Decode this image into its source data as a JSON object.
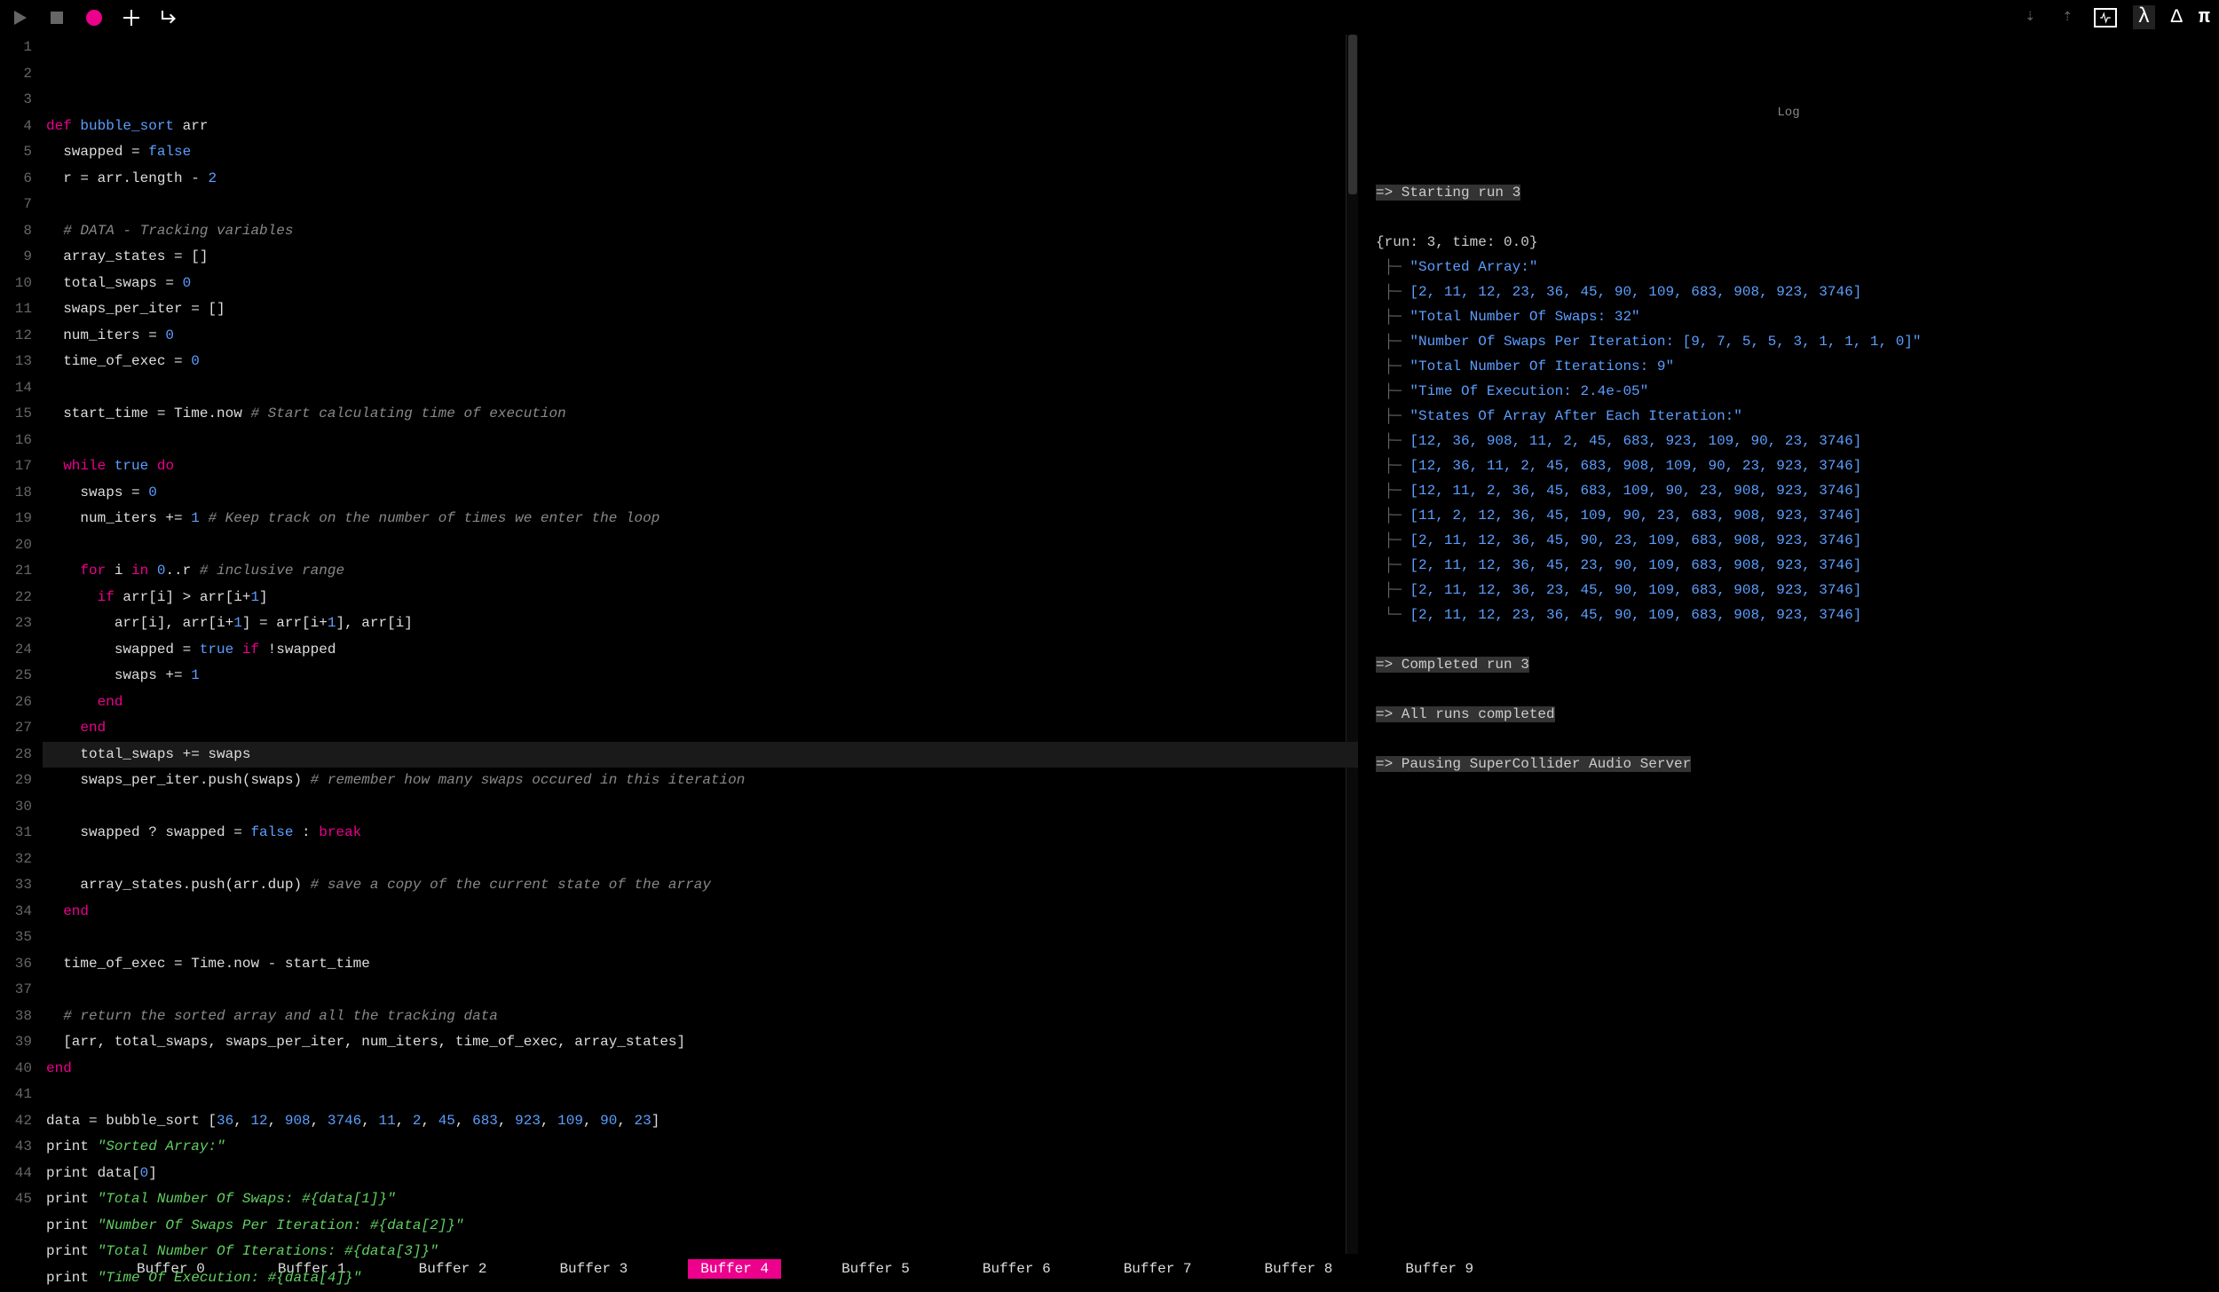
{
  "toolbar": {
    "icons_left": [
      "play-icon",
      "stop-icon",
      "record-icon",
      "plus-icon",
      "return-icon"
    ],
    "icons_right": [
      "drag-down-icon",
      "drag-up-icon",
      "activity-icon",
      "lambda-icon",
      "delta-icon",
      "pi-icon"
    ]
  },
  "editor": {
    "highlighted_line": 28,
    "cursor_col": 21,
    "lines": [
      {
        "n": 1,
        "tokens": [
          [
            "kw",
            "def "
          ],
          [
            "fn",
            "bubble_sort"
          ],
          [
            "txt",
            " arr"
          ]
        ]
      },
      {
        "n": 2,
        "tokens": [
          [
            "txt",
            "  swapped = "
          ],
          [
            "bool",
            "false"
          ]
        ]
      },
      {
        "n": 3,
        "tokens": [
          [
            "txt",
            "  r = arr.length - "
          ],
          [
            "num",
            "2"
          ]
        ]
      },
      {
        "n": 4,
        "tokens": []
      },
      {
        "n": 5,
        "tokens": [
          [
            "txt",
            "  "
          ],
          [
            "cm",
            "# DATA - Tracking variables"
          ]
        ]
      },
      {
        "n": 6,
        "tokens": [
          [
            "txt",
            "  array_states = []"
          ]
        ]
      },
      {
        "n": 7,
        "tokens": [
          [
            "txt",
            "  total_swaps = "
          ],
          [
            "num",
            "0"
          ]
        ]
      },
      {
        "n": 8,
        "tokens": [
          [
            "txt",
            "  swaps_per_iter = []"
          ]
        ]
      },
      {
        "n": 9,
        "tokens": [
          [
            "txt",
            "  num_iters = "
          ],
          [
            "num",
            "0"
          ]
        ]
      },
      {
        "n": 10,
        "tokens": [
          [
            "txt",
            "  time_of_exec = "
          ],
          [
            "num",
            "0"
          ]
        ]
      },
      {
        "n": 11,
        "tokens": []
      },
      {
        "n": 12,
        "tokens": [
          [
            "txt",
            "  start_time = Time.now "
          ],
          [
            "cm",
            "# Start calculating time of execution"
          ]
        ]
      },
      {
        "n": 13,
        "tokens": []
      },
      {
        "n": 14,
        "tokens": [
          [
            "txt",
            "  "
          ],
          [
            "kw",
            "while"
          ],
          [
            "txt",
            " "
          ],
          [
            "bool",
            "true"
          ],
          [
            "txt",
            " "
          ],
          [
            "kw",
            "do"
          ]
        ]
      },
      {
        "n": 15,
        "tokens": [
          [
            "txt",
            "    swaps = "
          ],
          [
            "num",
            "0"
          ]
        ]
      },
      {
        "n": 16,
        "tokens": [
          [
            "txt",
            "    num_iters += "
          ],
          [
            "num",
            "1"
          ],
          [
            "txt",
            " "
          ],
          [
            "cm",
            "# Keep track on the number of times we enter the loop"
          ]
        ]
      },
      {
        "n": 17,
        "tokens": []
      },
      {
        "n": 18,
        "tokens": [
          [
            "txt",
            "    "
          ],
          [
            "kw",
            "for"
          ],
          [
            "txt",
            " i "
          ],
          [
            "kw",
            "in"
          ],
          [
            "txt",
            " "
          ],
          [
            "num",
            "0"
          ],
          [
            "txt",
            "..r "
          ],
          [
            "cm",
            "# inclusive range"
          ]
        ]
      },
      {
        "n": 19,
        "tokens": [
          [
            "txt",
            "      "
          ],
          [
            "kw",
            "if"
          ],
          [
            "txt",
            " arr[i] > arr[i+"
          ],
          [
            "num",
            "1"
          ],
          [
            "txt",
            "]"
          ]
        ]
      },
      {
        "n": 20,
        "tokens": [
          [
            "txt",
            "        arr[i], arr[i+"
          ],
          [
            "num",
            "1"
          ],
          [
            "txt",
            "] = arr[i+"
          ],
          [
            "num",
            "1"
          ],
          [
            "txt",
            "], arr[i]"
          ]
        ]
      },
      {
        "n": 21,
        "tokens": [
          [
            "txt",
            "        swapped = "
          ],
          [
            "bool",
            "true"
          ],
          [
            "txt",
            " "
          ],
          [
            "kw",
            "if"
          ],
          [
            "txt",
            " !swapped"
          ]
        ]
      },
      {
        "n": 22,
        "tokens": [
          [
            "txt",
            "        swaps += "
          ],
          [
            "num",
            "1"
          ]
        ]
      },
      {
        "n": 23,
        "tokens": [
          [
            "txt",
            "      "
          ],
          [
            "kw",
            "end"
          ]
        ]
      },
      {
        "n": 24,
        "tokens": [
          [
            "txt",
            "    "
          ],
          [
            "kw",
            "end"
          ]
        ]
      },
      {
        "n": 25,
        "tokens": [
          [
            "txt",
            "    total_swaps += swaps"
          ]
        ]
      },
      {
        "n": 26,
        "tokens": [
          [
            "txt",
            "    swaps_per_iter.push(swaps) "
          ],
          [
            "cm",
            "# remember how many swaps occured in this iteration"
          ]
        ]
      },
      {
        "n": 27,
        "tokens": []
      },
      {
        "n": 28,
        "tokens": [
          [
            "txt",
            "    swapped ? swapped = "
          ],
          [
            "bool",
            "false"
          ],
          [
            "txt",
            " : "
          ],
          [
            "kw",
            "break"
          ]
        ]
      },
      {
        "n": 29,
        "tokens": []
      },
      {
        "n": 30,
        "tokens": [
          [
            "txt",
            "    array_states.push(arr.dup) "
          ],
          [
            "cm",
            "# save a copy of the current state of the array"
          ]
        ]
      },
      {
        "n": 31,
        "tokens": [
          [
            "txt",
            "  "
          ],
          [
            "kw",
            "end"
          ]
        ]
      },
      {
        "n": 32,
        "tokens": []
      },
      {
        "n": 33,
        "tokens": [
          [
            "txt",
            "  time_of_exec = Time.now - start_time"
          ]
        ]
      },
      {
        "n": 34,
        "tokens": []
      },
      {
        "n": 35,
        "tokens": [
          [
            "txt",
            "  "
          ],
          [
            "cm",
            "# return the sorted array and all the tracking data"
          ]
        ]
      },
      {
        "n": 36,
        "tokens": [
          [
            "txt",
            "  [arr, total_swaps, swaps_per_iter, num_iters, time_of_exec, array_states]"
          ]
        ]
      },
      {
        "n": 37,
        "tokens": [
          [
            "kw",
            "end"
          ]
        ]
      },
      {
        "n": 38,
        "tokens": []
      },
      {
        "n": 39,
        "tokens": [
          [
            "txt",
            "data = bubble_sort ["
          ],
          [
            "num",
            "36"
          ],
          [
            "txt",
            ", "
          ],
          [
            "num",
            "12"
          ],
          [
            "txt",
            ", "
          ],
          [
            "num",
            "908"
          ],
          [
            "txt",
            ", "
          ],
          [
            "num",
            "3746"
          ],
          [
            "txt",
            ", "
          ],
          [
            "num",
            "11"
          ],
          [
            "txt",
            ", "
          ],
          [
            "num",
            "2"
          ],
          [
            "txt",
            ", "
          ],
          [
            "num",
            "45"
          ],
          [
            "txt",
            ", "
          ],
          [
            "num",
            "683"
          ],
          [
            "txt",
            ", "
          ],
          [
            "num",
            "923"
          ],
          [
            "txt",
            ", "
          ],
          [
            "num",
            "109"
          ],
          [
            "txt",
            ", "
          ],
          [
            "num",
            "90"
          ],
          [
            "txt",
            ", "
          ],
          [
            "num",
            "23"
          ],
          [
            "txt",
            "]"
          ]
        ]
      },
      {
        "n": 40,
        "tokens": [
          [
            "txt",
            "print "
          ],
          [
            "str",
            "\"Sorted Array:\""
          ]
        ]
      },
      {
        "n": 41,
        "tokens": [
          [
            "txt",
            "print data["
          ],
          [
            "num",
            "0"
          ],
          [
            "txt",
            "]"
          ]
        ]
      },
      {
        "n": 42,
        "tokens": [
          [
            "txt",
            "print "
          ],
          [
            "str",
            "\"Total Number Of Swaps: #{data[1]}\""
          ]
        ]
      },
      {
        "n": 43,
        "tokens": [
          [
            "txt",
            "print "
          ],
          [
            "str",
            "\"Number Of Swaps Per Iteration: #{data[2]}\""
          ]
        ]
      },
      {
        "n": 44,
        "tokens": [
          [
            "txt",
            "print "
          ],
          [
            "str",
            "\"Total Number Of Iterations: #{data[3]}\""
          ]
        ]
      },
      {
        "n": 45,
        "tokens": [
          [
            "txt",
            "print "
          ],
          [
            "str",
            "\"Time Of Execution: #{data[4]}\""
          ]
        ]
      }
    ]
  },
  "log": {
    "title": "Log",
    "lines": [
      {
        "cls": "log-hdr",
        "text": "=> Starting run 3"
      },
      {
        "cls": "log-info",
        "text": ""
      },
      {
        "cls": "log-info",
        "text": "{run: 3, time: 0.0}"
      },
      {
        "cls": "log-blue",
        "tree": " ├─ ",
        "text": "\"Sorted Array:\""
      },
      {
        "cls": "log-blue",
        "tree": " ├─ ",
        "text": "[2, 11, 12, 23, 36, 45, 90, 109, 683, 908, 923, 3746]"
      },
      {
        "cls": "log-blue",
        "tree": " ├─ ",
        "text": "\"Total Number Of Swaps: 32\""
      },
      {
        "cls": "log-blue",
        "tree": " ├─ ",
        "text": "\"Number Of Swaps Per Iteration: [9, 7, 5, 5, 3, 1, 1, 1, 0]\""
      },
      {
        "cls": "log-blue",
        "tree": " ├─ ",
        "text": "\"Total Number Of Iterations: 9\""
      },
      {
        "cls": "log-blue",
        "tree": " ├─ ",
        "text": "\"Time Of Execution: 2.4e-05\""
      },
      {
        "cls": "log-blue",
        "tree": " ├─ ",
        "text": "\"States Of Array After Each Iteration:\""
      },
      {
        "cls": "log-blue",
        "tree": " ├─ ",
        "text": "[12, 36, 908, 11, 2, 45, 683, 923, 109, 90, 23, 3746]"
      },
      {
        "cls": "log-blue",
        "tree": " ├─ ",
        "text": "[12, 36, 11, 2, 45, 683, 908, 109, 90, 23, 923, 3746]"
      },
      {
        "cls": "log-blue",
        "tree": " ├─ ",
        "text": "[12, 11, 2, 36, 45, 683, 109, 90, 23, 908, 923, 3746]"
      },
      {
        "cls": "log-blue",
        "tree": " ├─ ",
        "text": "[11, 2, 12, 36, 45, 109, 90, 23, 683, 908, 923, 3746]"
      },
      {
        "cls": "log-blue",
        "tree": " ├─ ",
        "text": "[2, 11, 12, 36, 45, 90, 23, 109, 683, 908, 923, 3746]"
      },
      {
        "cls": "log-blue",
        "tree": " ├─ ",
        "text": "[2, 11, 12, 36, 45, 23, 90, 109, 683, 908, 923, 3746]"
      },
      {
        "cls": "log-blue",
        "tree": " ├─ ",
        "text": "[2, 11, 12, 36, 23, 45, 90, 109, 683, 908, 923, 3746]"
      },
      {
        "cls": "log-blue",
        "tree": " └─ ",
        "text": "[2, 11, 12, 23, 36, 45, 90, 109, 683, 908, 923, 3746]"
      },
      {
        "cls": "log-info",
        "text": ""
      },
      {
        "cls": "log-hdr",
        "text": "=> Completed run 3"
      },
      {
        "cls": "log-info",
        "text": ""
      },
      {
        "cls": "log-hdr",
        "text": "=> All runs completed"
      },
      {
        "cls": "log-info",
        "text": ""
      },
      {
        "cls": "log-hdr",
        "text": "=> Pausing SuperCollider Audio Server"
      }
    ]
  },
  "buffers": {
    "active": 4,
    "items": [
      "Buffer 0",
      "Buffer 1",
      "Buffer 2",
      "Buffer 3",
      "Buffer 4",
      "Buffer 5",
      "Buffer 6",
      "Buffer 7",
      "Buffer 8",
      "Buffer 9"
    ]
  }
}
